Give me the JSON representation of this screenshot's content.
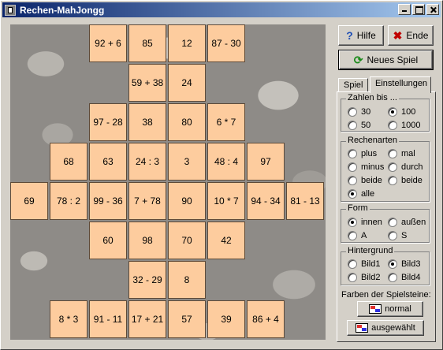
{
  "window": {
    "title": "Rechen-MahJongg"
  },
  "buttons": {
    "help": {
      "label": "Hilfe",
      "accel": "H"
    },
    "end": {
      "label": "Ende",
      "accel": "E"
    },
    "new_game": {
      "label": "Neues Spiel",
      "accel": "N"
    }
  },
  "tabs": [
    {
      "label": "Spiel",
      "active": false
    },
    {
      "label": "Einstellungen",
      "active": true
    }
  ],
  "groups": {
    "numbers": {
      "label": "Zahlen bis ...",
      "options": [
        "30",
        "100",
        "50",
        "1000"
      ],
      "selected": "100"
    },
    "operations": {
      "label": "Rechenarten",
      "options": [
        "plus",
        "mal",
        "minus",
        "durch",
        "beide",
        "beide",
        "alle"
      ],
      "selected": "alle"
    },
    "shape": {
      "label": "Form",
      "options": [
        "innen",
        "außen",
        "A",
        "S"
      ],
      "selected": "innen"
    },
    "background": {
      "label": "Hintergrund",
      "options": [
        "Bild1",
        "Bild3",
        "Bild2",
        "Bild4"
      ],
      "selected": "Bild3"
    }
  },
  "tile_colors": {
    "label": "Farben der Spielsteine:",
    "normal": "normal",
    "selected": "ausgewählt"
  },
  "tiles": [
    "92 + 6",
    "85",
    "12",
    "87 - 30",
    "59 + 38",
    "24",
    "97 - 28",
    "38",
    "80",
    "6 * 7",
    "68",
    "63",
    "24 : 3",
    "3",
    "48 : 4",
    "97",
    "69",
    "78 : 2",
    "99 - 36",
    "7 + 78",
    "90",
    "10 * 7",
    "94 - 34",
    "81 - 13",
    "60",
    "98",
    "70",
    "42",
    "32 - 29",
    "8",
    "8 * 3",
    "91 - 11",
    "17 + 21",
    "57",
    "39",
    "86 + 4"
  ],
  "colors": {
    "title_start": "#0a246a",
    "title_end": "#a6caf0",
    "tile": "#fdcc9e",
    "face": "#d4d0c8"
  }
}
